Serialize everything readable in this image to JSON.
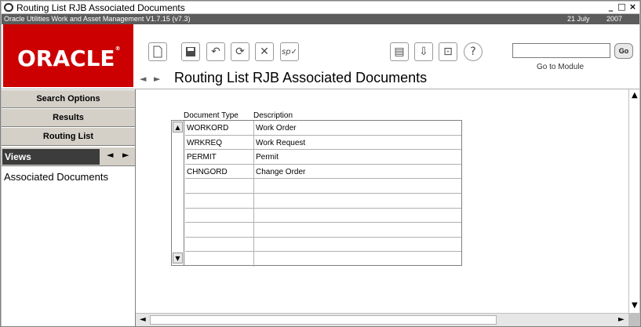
{
  "window": {
    "title": "Routing List RJB Associated Documents",
    "subtitle": "Oracle Utilities Work and Asset Management V1.7.15 (v7.3)",
    "date": "21 July",
    "year": "2007",
    "controls": [
      "_",
      "□",
      "×"
    ]
  },
  "header": {
    "logo": "ORACLE",
    "page_title": "Routing List RJB Associated Documents",
    "nav_prev": "◄",
    "nav_next": "►",
    "goto_label": "Go to Module",
    "goto_value": "",
    "go_button": "Go",
    "toolbar_icons": [
      "new-icon",
      "save-icon",
      "undo-icon",
      "refresh-icon",
      "delete-icon",
      "spell-check-icon",
      "report-icon",
      "routing-icon",
      "tray-icon",
      "help-icon"
    ]
  },
  "sidebar": {
    "buttons": [
      "Search Options",
      "Results",
      "Routing List"
    ],
    "views_label": "Views",
    "views_prev": "◄",
    "views_next": "►",
    "view_item": "Associated Documents"
  },
  "table": {
    "columns": [
      "Document Type",
      "Description"
    ],
    "rows": [
      [
        "WORKORD",
        "Work Order"
      ],
      [
        "WRKREQ",
        "Work Request"
      ],
      [
        "PERMIT",
        "Permit"
      ],
      [
        "CHNGORD",
        "Change Order"
      ],
      [
        "",
        ""
      ],
      [
        "",
        ""
      ],
      [
        "",
        ""
      ],
      [
        "",
        ""
      ],
      [
        "",
        ""
      ],
      [
        "",
        ""
      ]
    ]
  }
}
